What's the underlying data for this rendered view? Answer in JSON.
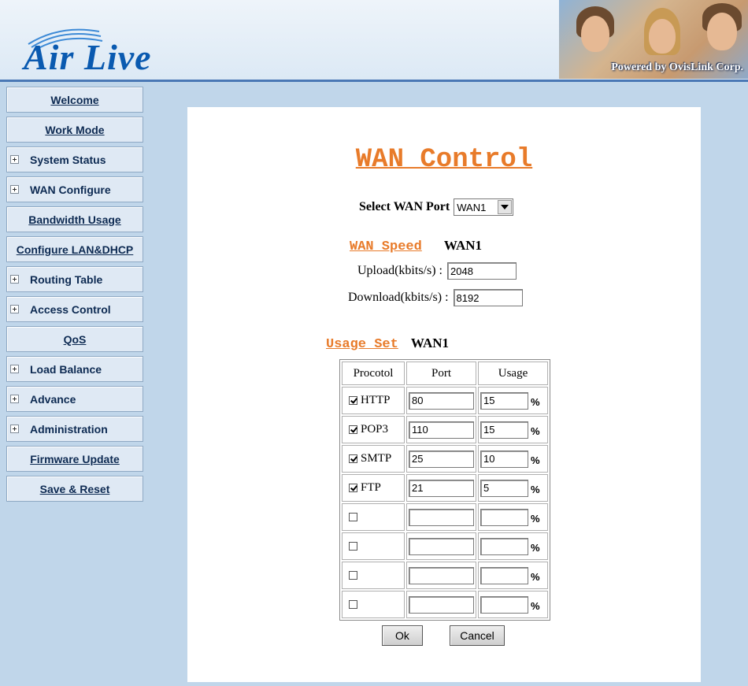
{
  "brand": {
    "logo_text": "Air Live",
    "banner_caption": "Powered by OvisLink Corp."
  },
  "sidebar": {
    "items": [
      {
        "label": "Welcome",
        "expandable": false
      },
      {
        "label": "Work Mode",
        "expandable": false
      },
      {
        "label": "System Status",
        "expandable": true
      },
      {
        "label": "WAN Configure",
        "expandable": true
      },
      {
        "label": "Bandwidth Usage",
        "expandable": false
      },
      {
        "label": "Configure LAN&DHCP",
        "expandable": false
      },
      {
        "label": "Routing Table",
        "expandable": true
      },
      {
        "label": "Access Control",
        "expandable": true
      },
      {
        "label": "QoS",
        "expandable": false
      },
      {
        "label": "Load Balance",
        "expandable": true
      },
      {
        "label": "Advance",
        "expandable": true
      },
      {
        "label": "Administration",
        "expandable": true
      },
      {
        "label": "Firmware Update",
        "expandable": false
      },
      {
        "label": "Save & Reset",
        "expandable": false
      }
    ]
  },
  "main": {
    "title": "WAN Control",
    "select_label": "Select WAN Port",
    "selected_port": "WAN1",
    "speed": {
      "heading": "WAN Speed",
      "port": "WAN1",
      "upload_label": "Upload(kbits/s) :",
      "upload_value": "2048",
      "download_label": "Download(kbits/s) :",
      "download_value": "8192"
    },
    "usage": {
      "heading": "Usage Set",
      "port": "WAN1",
      "columns": [
        "Procotol",
        "Port",
        "Usage"
      ],
      "percent_symbol": "%",
      "rows": [
        {
          "checked": true,
          "protocol": "HTTP",
          "port": "80",
          "usage": "15"
        },
        {
          "checked": true,
          "protocol": "POP3",
          "port": "110",
          "usage": "15"
        },
        {
          "checked": true,
          "protocol": "SMTP",
          "port": "25",
          "usage": "10"
        },
        {
          "checked": true,
          "protocol": "FTP",
          "port": "21",
          "usage": "5"
        },
        {
          "checked": false,
          "protocol": "",
          "port": "",
          "usage": ""
        },
        {
          "checked": false,
          "protocol": "",
          "port": "",
          "usage": ""
        },
        {
          "checked": false,
          "protocol": "",
          "port": "",
          "usage": ""
        },
        {
          "checked": false,
          "protocol": "",
          "port": "",
          "usage": ""
        }
      ]
    },
    "buttons": {
      "ok": "Ok",
      "cancel": "Cancel"
    }
  },
  "colors": {
    "background": "#c0d6ea",
    "accent_orange": "#e87b2a",
    "logo_blue": "#0a5ab0",
    "nav_text": "#0d2a52"
  }
}
